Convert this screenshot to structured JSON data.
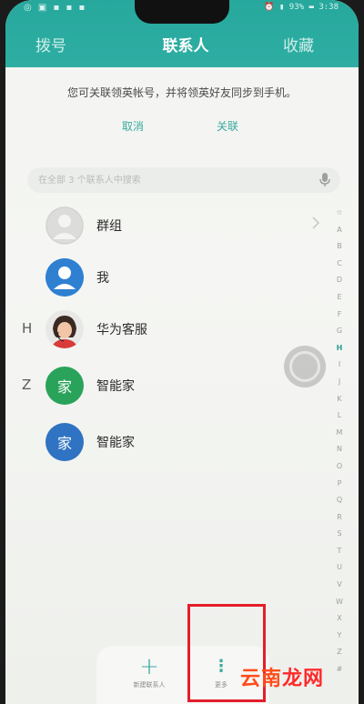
{
  "status": {
    "left_icons": "◎ ▣ ▪ ▪ ▪",
    "right_text": "⏰ ▮ 93% ▬ 3:38"
  },
  "tabs": [
    {
      "label": "拨号",
      "active": false
    },
    {
      "label": "联系人",
      "active": true
    },
    {
      "label": "收藏",
      "active": false
    }
  ],
  "banner": {
    "text": "您可关联领英帐号，并将领英好友同步到手机。",
    "cancel": "取消",
    "link": "关联"
  },
  "search": {
    "placeholder": "在全部 3 个联系人中搜索"
  },
  "contacts": [
    {
      "letter": "",
      "name": "群组",
      "avatar": "group-icon"
    },
    {
      "letter": "",
      "name": "我",
      "avatar": "person-icon"
    },
    {
      "letter": "H",
      "name": "华为客服",
      "avatar": "photo"
    },
    {
      "letter": "Z",
      "name": "智能家",
      "avatar_text": "家",
      "color": "#2aa35a"
    },
    {
      "letter": "",
      "name": "智能家",
      "avatar_text": "家",
      "color": "#2f73c2"
    }
  ],
  "index": [
    "☆",
    "A",
    "B",
    "C",
    "D",
    "E",
    "F",
    "G",
    "H",
    "I",
    "J",
    "K",
    "L",
    "M",
    "N",
    "O",
    "P",
    "Q",
    "R",
    "S",
    "T",
    "U",
    "V",
    "W",
    "X",
    "Y",
    "Z",
    "#"
  ],
  "index_active": "H",
  "bottom": {
    "new_label": "新建联系人",
    "more_label": "更多"
  },
  "watermark": {
    "part1": "云南",
    "part2": "龙网"
  },
  "colors": {
    "accent": "#2eaea3",
    "highlight": "#e41e2b"
  }
}
